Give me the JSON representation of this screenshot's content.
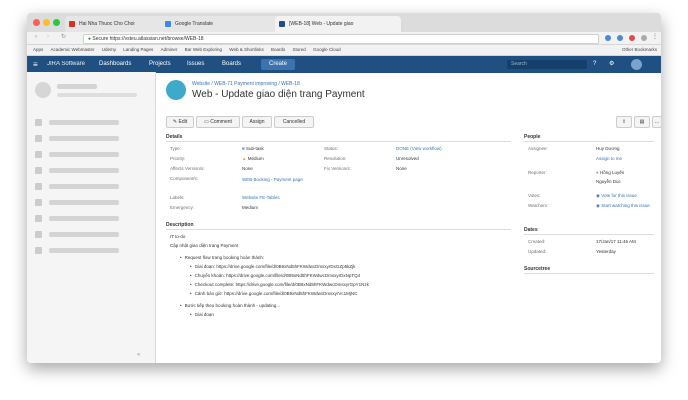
{
  "browser": {
    "tabs": [
      {
        "label": "Hai Nha Thuoc Cho Choi",
        "color": "#d93025"
      },
      {
        "label": "Google Translate",
        "color": "#4285f4"
      },
      {
        "label": "[WEB-18] Web - Update giao",
        "color": "#205081"
      }
    ],
    "url": "Secure https://vsteu.atlassian.net/browse/WEB-18",
    "bookmarks": [
      "Apps",
      "Academic Webmaster",
      "Udemy",
      "Landing Pages",
      "Adminer",
      "Bar Web Exploring",
      "Web & Shortlinks",
      "Boards",
      "Stored",
      "Google Cloud",
      "Other Bookmarks"
    ]
  },
  "navbar": {
    "logo": "JIRA Software",
    "items": [
      "Dashboards",
      "Projects",
      "Issues",
      "Boards",
      "Create"
    ],
    "search_placeholder": "Search"
  },
  "issue": {
    "breadcrumb": "Website / WEB-71 Payment improving / WEB-18",
    "title": "Web - Update giao diện trang Payment",
    "actions": [
      "Edit",
      "Comment",
      "Assign",
      "Cancelled"
    ],
    "details_heading": "Details",
    "fields_left": [
      {
        "label": "Type:",
        "value": "Sub-task"
      },
      {
        "label": "Priority:",
        "value": "Medium"
      },
      {
        "label": "Affects Version/s:",
        "value": "None"
      },
      {
        "label": "Component/s:",
        "value": "WEB Booking - Payment page"
      },
      {
        "label": "Labels:",
        "value": "Website  FE-Tables"
      },
      {
        "label": "Emergency:",
        "value": "Medium"
      }
    ],
    "fields_right": [
      {
        "label": "Status:",
        "value": "DONE  (View workflow)"
      },
      {
        "label": "Resolution:",
        "value": "Unresolved"
      },
      {
        "label": "Fix Version/s:",
        "value": "None"
      }
    ],
    "people_heading": "People",
    "people": [
      {
        "label": "Assignee:",
        "value": "Huy Dương"
      },
      {
        "label": "",
        "value": "Assign to me"
      },
      {
        "label": "Reporter:",
        "value": "Hồng Luyến"
      },
      {
        "label": "",
        "value": "Nguyễn Duc"
      },
      {
        "label": "Votes:",
        "value": "Vote for this issue"
      },
      {
        "label": "Watchers:",
        "value": "Start watching this issue"
      }
    ],
    "dates_heading": "Dates",
    "dates": [
      {
        "label": "Created:",
        "value": "17/Jan/17 11:46 AM"
      },
      {
        "label": "Updated:",
        "value": "Yesterday"
      }
    ],
    "sourcetree_heading": "Sourcetree",
    "description_heading": "Description",
    "description": [
      {
        "text": "IT to-do",
        "indent": 0,
        "bullet": false
      },
      {
        "text": "Cập nhật giao diện trang Payment",
        "indent": 0,
        "bullet": false
      },
      {
        "text": "Request flow trang booking hoàn thành:",
        "indent": 1,
        "bullet": true
      },
      {
        "text": "Giai đoạn: https://drive.google.com/file/d/0B9xNd5hFKWdwcDmsxyrDxGZp5kZjk",
        "indent": 2,
        "bullet": true
      },
      {
        "text": "Chuyển khoản: https://drive.google.com/file/d/0B9xNd5hFKWdwcDmsxyrDxNpTQ4",
        "indent": 2,
        "bullet": true
      },
      {
        "text": "Checkout complete: https://drive.google.com/file/d/0B9xNd5hFKWdwcDmsxyrGpY1Nzk",
        "indent": 2,
        "bullet": true
      },
      {
        "text": "Cảnh báo giờ: https://drive.google.com/file/d/0B9xNd5hFKWdwcDmsxyrVc1MjNC",
        "indent": 2,
        "bullet": true
      },
      {
        "text": "Bước tiếp theo booking hoàn thành - updating...",
        "indent": 1,
        "bullet": true
      },
      {
        "text": "Giai đoạn",
        "indent": 2,
        "bullet": true
      }
    ]
  }
}
